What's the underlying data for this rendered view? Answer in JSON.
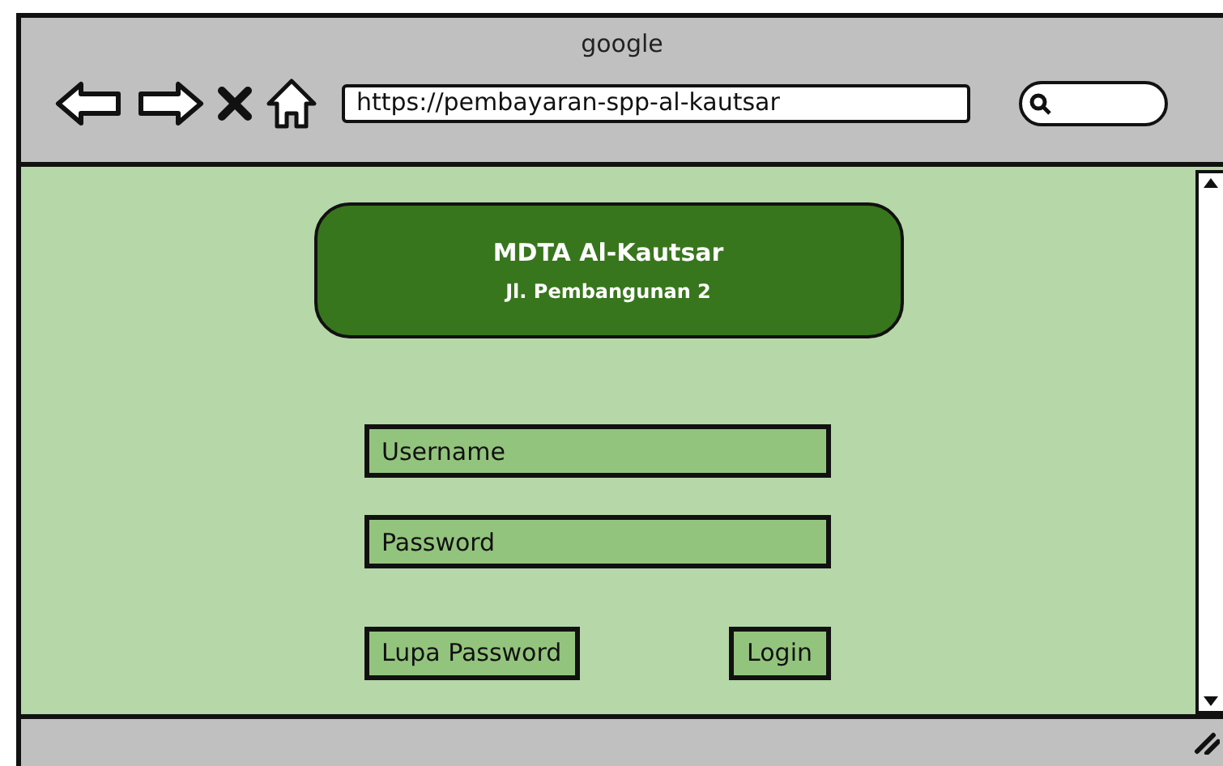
{
  "window": {
    "title": "google"
  },
  "toolbar": {
    "address": "https://pembayaran-spp-al-kautsar"
  },
  "header": {
    "title": "MDTA Al-Kautsar",
    "subtitle": "Jl. Pembangunan 2"
  },
  "form": {
    "fields": [
      {
        "placeholder": "Username"
      },
      {
        "placeholder": "Password"
      }
    ],
    "buttons": [
      {
        "label": "Lupa Password"
      },
      {
        "label": "Login"
      }
    ]
  }
}
